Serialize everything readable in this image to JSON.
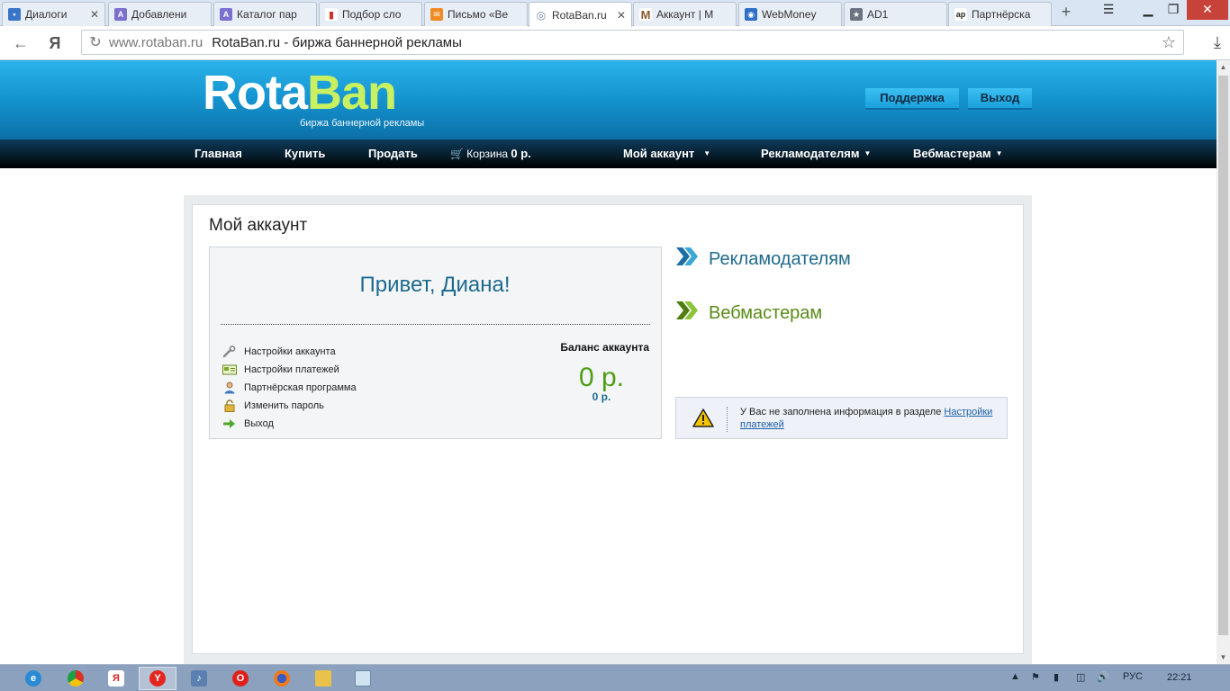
{
  "browser": {
    "tabs": [
      {
        "label": "Диалоги",
        "icon": "chat-icon",
        "color": "#3a76c7",
        "active": false
      },
      {
        "label": "Добавлени",
        "icon": "ad-icon",
        "color": "#7b6fd0",
        "active": false
      },
      {
        "label": "Каталог пар",
        "icon": "ad-icon",
        "color": "#7b6fd0",
        "active": false
      },
      {
        "label": "Подбор сло",
        "icon": "bar-chart-icon",
        "color": "#d22f2f",
        "active": false
      },
      {
        "label": "Письмо «Ве",
        "icon": "mail-icon",
        "color": "#f08a24",
        "active": false
      },
      {
        "label": "RotaBan.ru",
        "icon": "target-icon",
        "color": "#9aa7b4",
        "active": true
      },
      {
        "label": "Аккаунт | М",
        "icon": "m-icon",
        "color": "#8a5a2a",
        "active": false
      },
      {
        "label": "WebMoney",
        "icon": "globe-icon",
        "color": "#2f6fc4",
        "active": false
      },
      {
        "label": "AD1",
        "icon": "star-icon",
        "color": "#6b7480",
        "active": false
      },
      {
        "label": "Партнёрска",
        "icon": "ap-icon",
        "color": "#333333",
        "active": false
      }
    ],
    "address": {
      "host": "www.rotaban.ru",
      "title": "RotaBan.ru - биржа баннерной рекламы"
    }
  },
  "site": {
    "logo": {
      "part1": "Rota",
      "part2": "Ban",
      "tagline": "биржа баннерной рекламы"
    },
    "header_buttons": {
      "support": "Поддержка",
      "logout": "Выход"
    },
    "menu": {
      "home": "Главная",
      "buy": "Купить",
      "sell": "Продать",
      "cart_label": "Корзина",
      "cart_value": "0 р.",
      "my_account": "Мой аккаунт",
      "advertisers": "Рекламодателям",
      "webmasters": "Вебмастерам"
    },
    "page_title": "Мой аккаунт",
    "greeting": "Привет, Диана!",
    "account_links": [
      {
        "label": "Настройки аккаунта",
        "icon": "wrench-icon"
      },
      {
        "label": "Настройки платежей",
        "icon": "payment-card-icon"
      },
      {
        "label": "Партнёрская программа",
        "icon": "user-icon"
      },
      {
        "label": "Изменить пароль",
        "icon": "lock-icon"
      },
      {
        "label": "Выход",
        "icon": "arrow-right-icon"
      }
    ],
    "balance": {
      "label": "Баланс аккаунта",
      "main": "0 р.",
      "secondary": "0 р."
    },
    "side_links": {
      "advertisers": "Рекламодателям",
      "webmasters": "Вебмастерам"
    },
    "notice": {
      "text": "У Вас не заполнена информация в разделе ",
      "link": "Настройки платежей"
    }
  },
  "taskbar": {
    "language": "РУС",
    "clock": "22:21"
  },
  "colors": {
    "header_blue": "#1493cf",
    "accent_blue": "#1f6a8c",
    "accent_green": "#4f9d13"
  }
}
